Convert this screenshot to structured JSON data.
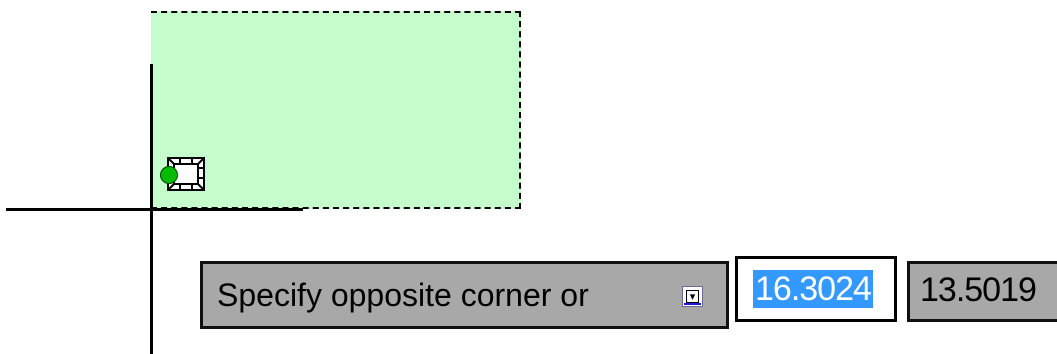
{
  "dynamic_input": {
    "prompt_text": "Specify opposite corner or",
    "options_icon": "arrow-down-options-icon",
    "x_value": "16.3024",
    "y_value": "13.5019"
  },
  "colors": {
    "selection_fill": "#c4fccc",
    "input_highlight": "#3399ff",
    "prompt_background": "#a8a8a8",
    "snap_marker": "#00bb00"
  },
  "icons": {
    "cursor": "pickbox-cursor-icon",
    "snap": "snap-marker-icon"
  }
}
